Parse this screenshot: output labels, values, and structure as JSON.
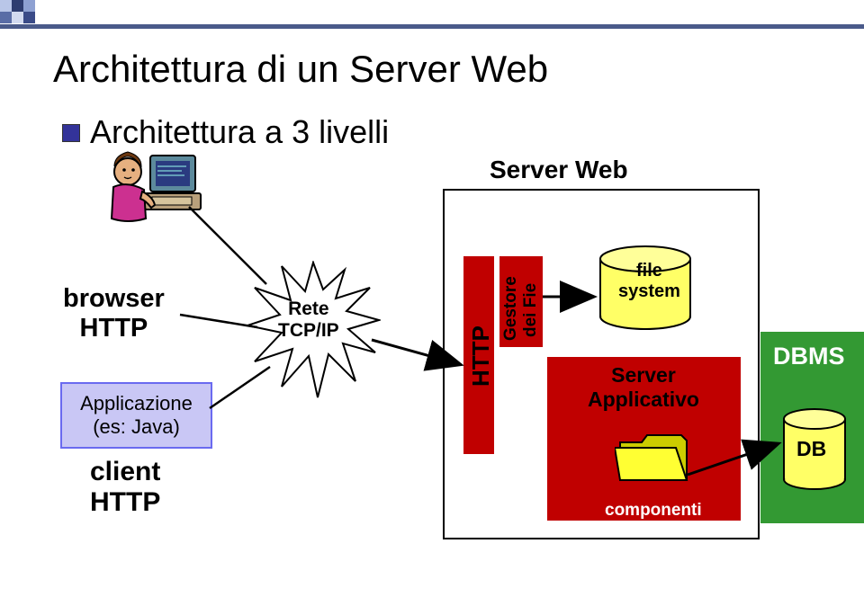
{
  "title": "Architettura di un Server Web",
  "bullet": "Architettura a 3 livelli",
  "client": {
    "browser": "browser\nHTTP",
    "application": "Applicazione\n(es: Java)",
    "label": "client\nHTTP"
  },
  "network": {
    "label": "Rete\nTCP/IP"
  },
  "server_web": {
    "label": "Server Web",
    "http_bar": "HTTP",
    "gestore_l1": "Gestore",
    "gestore_l2": "dei Fie",
    "filesystem": "file\nsystem",
    "appserver": "Server\nApplicativo",
    "components": "componenti"
  },
  "dbms": {
    "label": "DBMS",
    "db": "DB"
  },
  "colors": {
    "accent": "#333399",
    "server_item": "#c00000",
    "dbms_bg": "#339933",
    "cylinder": "#ffff66",
    "app_box_fill": "#c9c7f5",
    "app_box_border": "#6a6af0"
  },
  "chart_data": {
    "type": "diagram",
    "title": "Architettura di un Server Web — Architettura a 3 livelli",
    "nodes": [
      {
        "id": "user",
        "label": "utente",
        "tier": "client"
      },
      {
        "id": "browser",
        "label": "browser HTTP",
        "tier": "client"
      },
      {
        "id": "java_app",
        "label": "Applicazione (es: Java)",
        "tier": "client"
      },
      {
        "id": "client_http",
        "label": "client HTTP",
        "tier": "client",
        "group_of": [
          "browser",
          "java_app"
        ]
      },
      {
        "id": "network",
        "label": "Rete TCP/IP",
        "tier": "network"
      },
      {
        "id": "server_web",
        "label": "Server Web",
        "tier": "server",
        "contains": [
          "http_mod",
          "gestore",
          "filesystem",
          "app_server"
        ]
      },
      {
        "id": "http_mod",
        "label": "HTTP",
        "tier": "server"
      },
      {
        "id": "gestore",
        "label": "Gestore dei Fie",
        "tier": "server"
      },
      {
        "id": "filesystem",
        "label": "file system",
        "tier": "server"
      },
      {
        "id": "app_server",
        "label": "Server Applicativo",
        "tier": "server",
        "contains": [
          "componenti"
        ]
      },
      {
        "id": "componenti",
        "label": "componenti",
        "tier": "server"
      },
      {
        "id": "dbms",
        "label": "DBMS",
        "tier": "data",
        "contains": [
          "db"
        ]
      },
      {
        "id": "db",
        "label": "DB",
        "tier": "data"
      }
    ],
    "edges": [
      {
        "from": "user",
        "to": "network"
      },
      {
        "from": "browser",
        "to": "network"
      },
      {
        "from": "java_app",
        "to": "network"
      },
      {
        "from": "network",
        "to": "http_mod"
      },
      {
        "from": "gestore",
        "to": "filesystem"
      },
      {
        "from": "http_mod",
        "to": "app_server"
      },
      {
        "from": "app_server",
        "to": "dbms"
      },
      {
        "from": "componenti",
        "to": "db"
      }
    ]
  }
}
